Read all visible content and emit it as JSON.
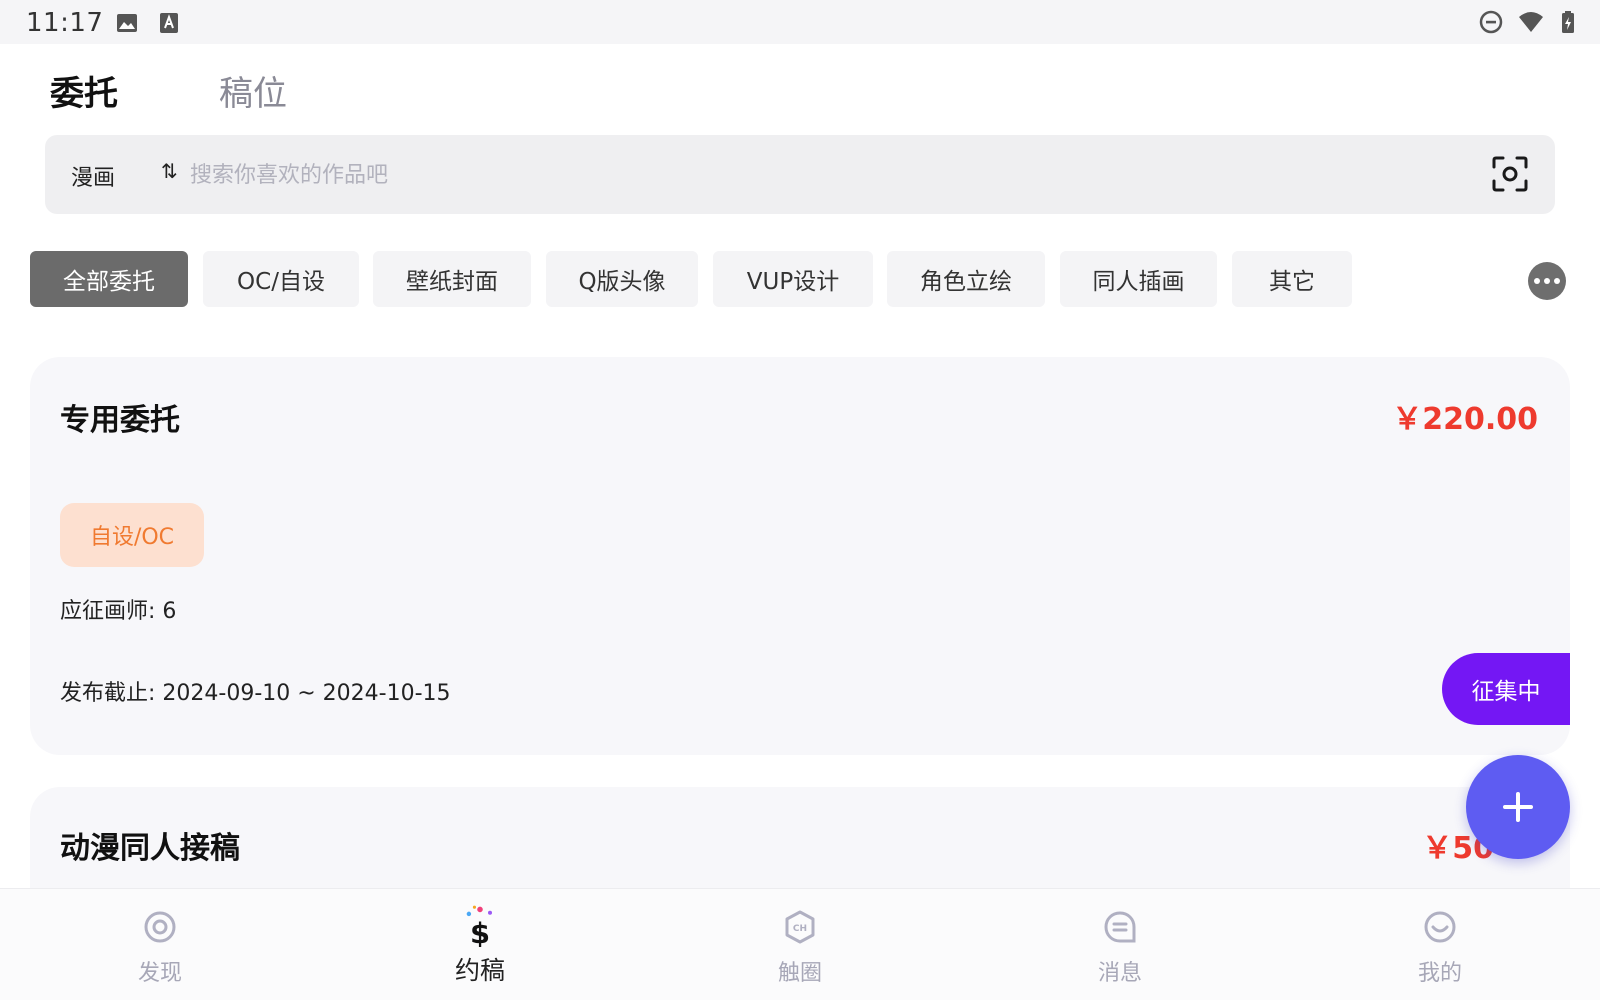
{
  "status_bar": {
    "time": "11:17",
    "left_icons": [
      "image-icon",
      "keyboard-a-icon"
    ],
    "right_icons": [
      "do-not-disturb-icon",
      "wifi-icon",
      "battery-charging-icon"
    ]
  },
  "top_tabs": [
    {
      "label": "委托",
      "active": true
    },
    {
      "label": "稿位",
      "active": false
    }
  ],
  "search": {
    "category": "漫画",
    "sort_icon": "sort-icon",
    "sort_glyph": "⇅",
    "placeholder": "搜索你喜欢的作品吧",
    "value": "",
    "scan_icon": "scan-icon"
  },
  "categories": [
    {
      "label": "全部委托",
      "active": true
    },
    {
      "label": "OC/自设",
      "active": false
    },
    {
      "label": "壁纸封面",
      "active": false
    },
    {
      "label": "Q版头像",
      "active": false
    },
    {
      "label": "VUP设计",
      "active": false
    },
    {
      "label": "角色立绘",
      "active": false
    },
    {
      "label": "同人插画",
      "active": false
    },
    {
      "label": "其它",
      "active": false
    }
  ],
  "cards": [
    {
      "title": "专用委托",
      "price": "￥220.00",
      "tag": "自设/OC",
      "applicants": "应征画师: 6",
      "deadline": "发布截止: 2024-09-10 ~ 2024-10-15",
      "status": "征集中"
    },
    {
      "title": "动漫同人接稿",
      "price": "￥50"
    }
  ],
  "fab": {
    "icon": "plus-icon",
    "glyph": "+"
  },
  "bottom_nav": [
    {
      "label": "发现",
      "icon": "discover-icon",
      "active": false
    },
    {
      "label": "约稿",
      "icon": "dollar-commission-icon",
      "active": true
    },
    {
      "label": "触圈",
      "icon": "circle-hexagon-icon",
      "active": false
    },
    {
      "label": "消息",
      "icon": "message-icon",
      "active": false
    },
    {
      "label": "我的",
      "icon": "profile-smile-icon",
      "active": false
    }
  ],
  "colors": {
    "accent_purple": "#7417f4",
    "fab_blue": "#5e5cf2",
    "price_red": "#ee3a2e",
    "tag_orange": "#f07a30",
    "tag_bg": "#fde0d0",
    "chip_active": "#6b6b6b"
  }
}
